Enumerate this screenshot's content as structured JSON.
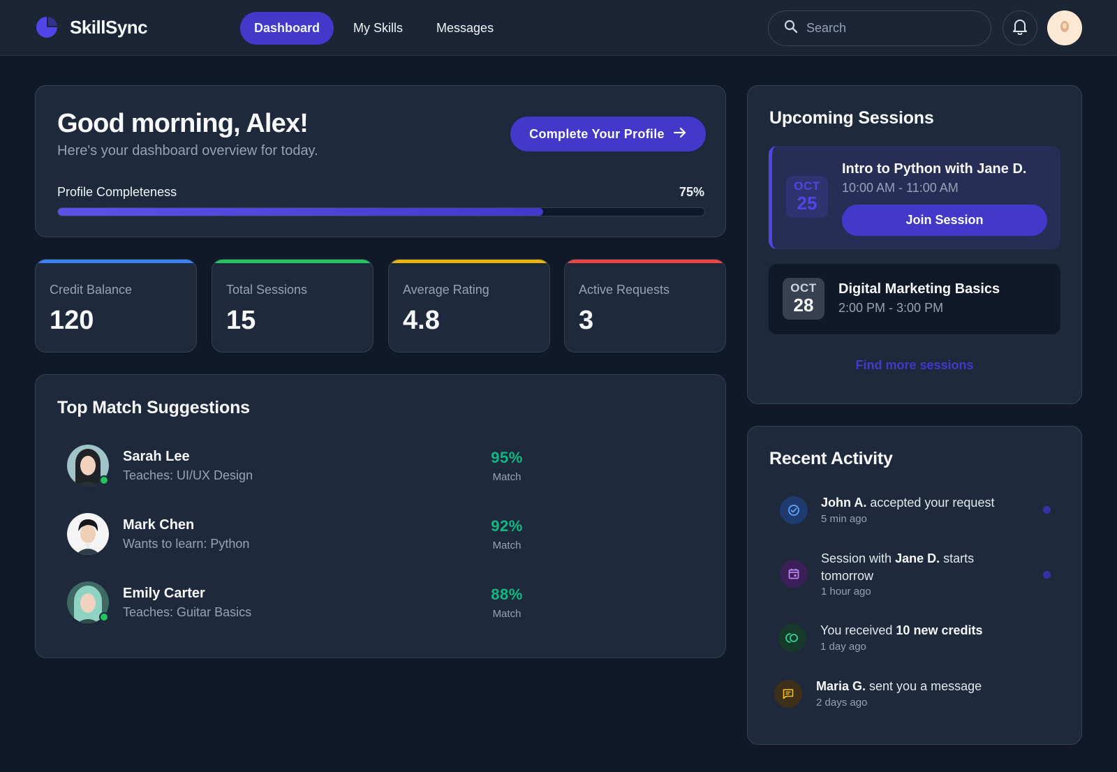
{
  "app": {
    "name": "SkillSync"
  },
  "nav": {
    "tabs": [
      {
        "label": "Dashboard",
        "active": true
      },
      {
        "label": "My Skills"
      },
      {
        "label": "Messages"
      }
    ]
  },
  "search": {
    "placeholder": "Search"
  },
  "icons": {
    "logo": "logo-icon",
    "search": "search-icon",
    "bell": "bell-icon",
    "user": "user-avatar-icon",
    "arrow": "arrow-right-icon"
  },
  "welcome": {
    "greeting": "Good morning, Alex!",
    "subtitle": "Here's your dashboard overview for today.",
    "cta_label": "Complete Your Profile",
    "progress_label": "Profile Completeness",
    "progress_value": "75%",
    "progress_fraction": 0.75
  },
  "stats": [
    {
      "label": "Credit Balance",
      "value": "120",
      "color": "#3b82f6"
    },
    {
      "label": "Total Sessions",
      "value": "15",
      "color": "#22c55e"
    },
    {
      "label": "Average Rating",
      "value": "4.8",
      "color": "#eab308"
    },
    {
      "label": "Active Requests",
      "value": "3",
      "color": "#ef4444"
    }
  ],
  "matches": {
    "title": "Top Match Suggestions",
    "match_label": "Match",
    "items": [
      {
        "name": "Sarah Lee",
        "subtitle": "Teaches: UI/UX Design",
        "percent": "95%",
        "online": true
      },
      {
        "name": "Mark Chen",
        "subtitle": "Wants to learn: Python",
        "percent": "92%",
        "online": false
      },
      {
        "name": "Emily Carter",
        "subtitle": "Teaches: Guitar Basics",
        "percent": "88%",
        "online": true
      }
    ]
  },
  "sessions": {
    "title": "Upcoming Sessions",
    "items": [
      {
        "month": "OCT",
        "day": "25",
        "title": "Intro to Python with Jane D.",
        "time": "10:00 AM - 11:00 AM",
        "button": "Join Session"
      },
      {
        "month": "OCT",
        "day": "28",
        "title": "Digital Marketing Basics",
        "time": "2:00 PM - 3:00 PM"
      }
    ],
    "find_more": "Find more sessions"
  },
  "activity": {
    "title": "Recent Activity",
    "items": [
      {
        "icon": "check-circle-icon",
        "pre": "",
        "bold": "John A.",
        "post": " accepted your request",
        "time": "5 min ago",
        "unread": true
      },
      {
        "icon": "calendar-icon",
        "pre": "Session with ",
        "bold": "Jane D.",
        "post": " starts tomorrow",
        "time": "1 hour ago",
        "unread": true
      },
      {
        "icon": "credits-icon",
        "pre": "You received ",
        "bold": "10 new credits",
        "post": "",
        "time": "1 day ago",
        "unread": false
      },
      {
        "icon": "message-icon",
        "pre": "",
        "bold": "Maria G.",
        "post": " sent you a message",
        "time": "2 days ago",
        "unread": false
      }
    ]
  }
}
